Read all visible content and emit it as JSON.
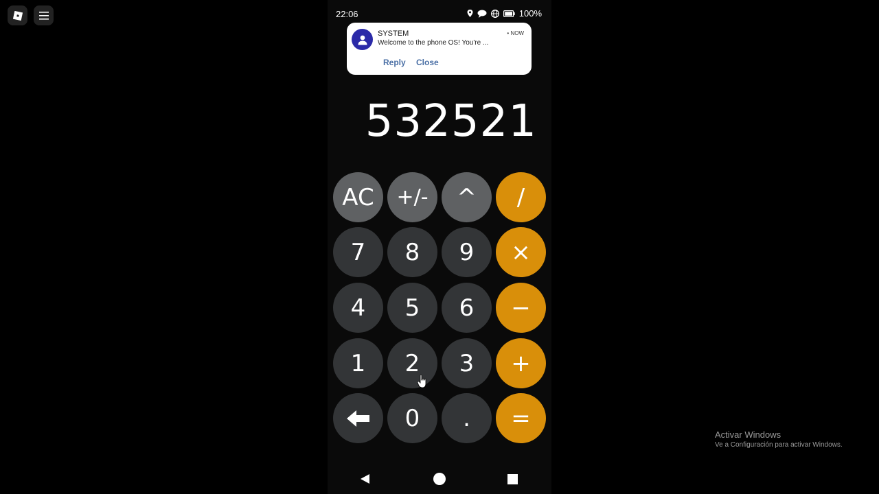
{
  "status_bar": {
    "time": "22:06",
    "battery": "100%",
    "icons": [
      "location-icon",
      "chat-icon",
      "globe-icon",
      "battery-icon"
    ]
  },
  "notification": {
    "sender": "SYSTEM",
    "time": "• NOW",
    "message": "Welcome to the phone OS! You're ...",
    "actions": {
      "reply": "Reply",
      "close": "Close"
    },
    "avatar_color": "#2b2aa8",
    "action_color": "#4a6fa5"
  },
  "calculator": {
    "display": "532521",
    "rows": [
      [
        "AC",
        "+/-",
        "^",
        "/"
      ],
      [
        "7",
        "8",
        "9",
        "×"
      ],
      [
        "4",
        "5",
        "6",
        "−"
      ],
      [
        "1",
        "2",
        "3",
        "+"
      ],
      [
        "backspace-icon",
        "0",
        ".",
        "="
      ]
    ],
    "colors": {
      "function": "#5f6163",
      "number": "#333537",
      "operator": "#d98f0a"
    }
  },
  "watermark": {
    "title": "Activar Windows",
    "subtitle": "Ve a Configuración para activar Windows."
  }
}
